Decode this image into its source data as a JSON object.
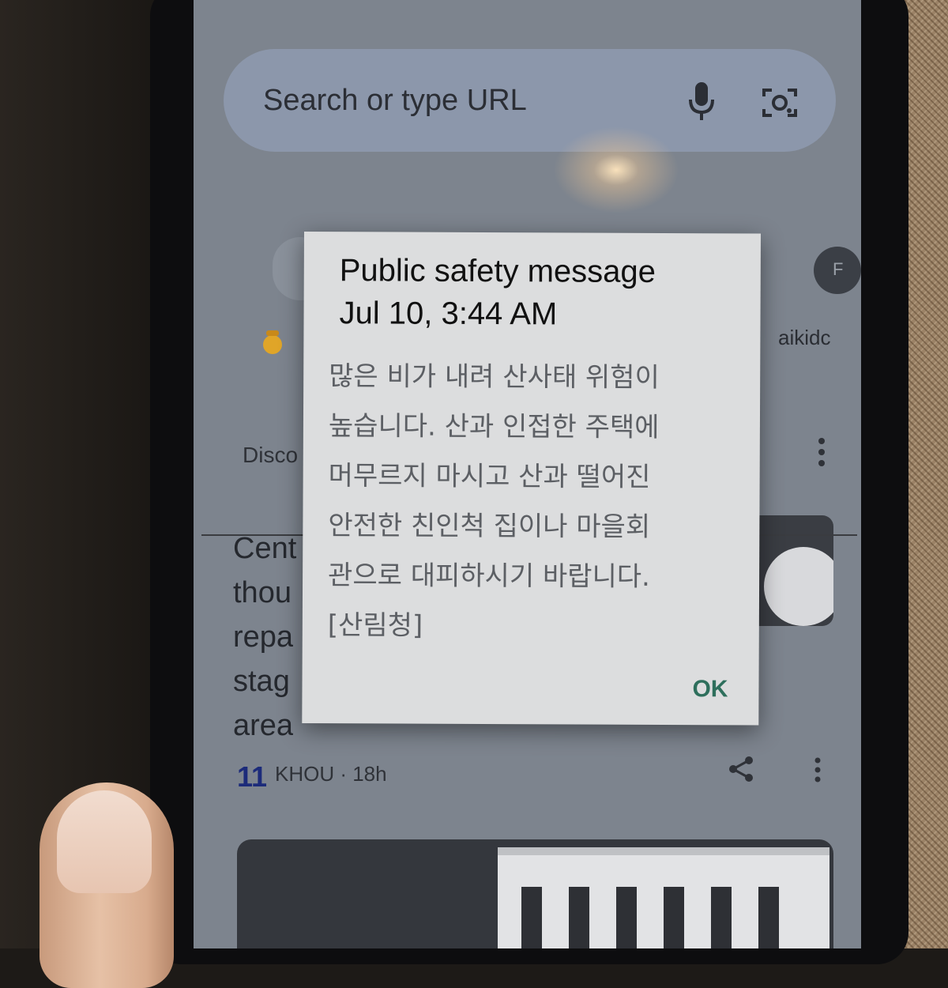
{
  "search": {
    "placeholder": "Search or type URL"
  },
  "shortcuts": {
    "right_label": "aikidc",
    "right_letter": "F"
  },
  "feed": {
    "section_label": "Disco",
    "card_title_lines": [
      "Cent",
      "thou",
      "repa",
      "stag",
      "area"
    ],
    "source_icon": "11",
    "source_label": "KHOU · 18h"
  },
  "dialog": {
    "title_line1": "Public safety message",
    "title_line2": "Jul 10, 3:44 AM",
    "body_lines": [
      "많은 비가 내려 산사태 위험이",
      "높습니다. 산과 인접한 주택에",
      "머무르지 마시고 산과 떨어진",
      "안전한 친인척 집이나 마을회",
      "관으로 대피하시기 바랍니다.",
      "[산림청]"
    ],
    "ok_label": "OK"
  },
  "colors": {
    "dialog_bg": "#dcddde",
    "ok_accent": "#2e6f5c",
    "search_bar": "#8c97ab"
  },
  "icons": [
    "mic-icon",
    "lens-icon",
    "more-vert-icon",
    "share-icon"
  ]
}
